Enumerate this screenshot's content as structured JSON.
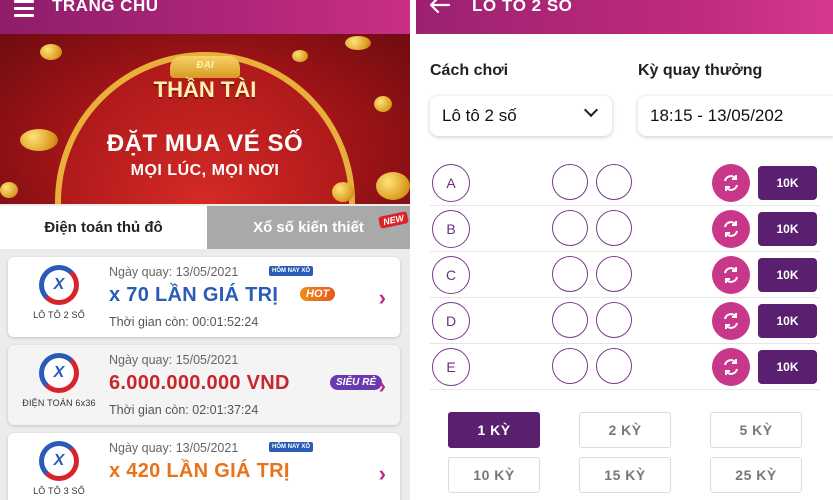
{
  "left": {
    "header_title": "TRANG CHỦ",
    "banner": {
      "logo_small": "ĐẠI",
      "logo_main": "THẦN TÀI",
      "headline": "ĐẶT MUA VÉ SỐ",
      "subline": "MỌI LÚC, MỌI NƠI"
    },
    "tabs": [
      {
        "label": "Điện toán thủ đô",
        "active": true
      },
      {
        "label": "Xổ số kiến thiết",
        "active": false,
        "badge": "NEW"
      }
    ],
    "games": [
      {
        "logo_name": "LÔ TÔ 2 SỐ",
        "date": "Ngày quay: 13/05/2021",
        "today_badge": "HÔM NAY XỔ",
        "prize": "x 70 LẦN GIÁ TRỊ",
        "prize_color": "#2a5bb8",
        "badge": "HOT",
        "remaining": "Thời gian còn: 00:01:52:24"
      },
      {
        "logo_name": "ĐIỆN TOÁN 6x36",
        "date": "Ngày quay: 15/05/2021",
        "prize": "6.000.000.000 VND",
        "prize_color": "#c8262a",
        "badge": "SIÊU RẺ",
        "remaining": "Thời gian còn: 02:01:37:24"
      },
      {
        "logo_name": "LÔ TÔ 3 SỐ",
        "date": "Ngày quay: 13/05/2021",
        "today_badge": "HÔM NAY XỔ",
        "prize": "x 420 LẦN GIÁ TRỊ",
        "prize_color": "#e8731b",
        "remaining": ""
      }
    ]
  },
  "right": {
    "header_title": "LÔ TÔ 2 SỐ",
    "play_mode_label": "Cách chơi",
    "play_mode_value": "Lô tô 2 số",
    "draw_label": "Kỳ quay thưởng",
    "draw_value": "18:15 - 13/05/202",
    "rows": [
      {
        "letter": "A",
        "price": "10K"
      },
      {
        "letter": "B",
        "price": "10K"
      },
      {
        "letter": "C",
        "price": "10K"
      },
      {
        "letter": "D",
        "price": "10K"
      },
      {
        "letter": "E",
        "price": "10K"
      }
    ],
    "periods": [
      {
        "label": "1 KỲ",
        "active": true
      },
      {
        "label": "2 KỲ",
        "active": false
      },
      {
        "label": "5 KỲ",
        "active": false
      },
      {
        "label": "10 KỲ",
        "active": false
      },
      {
        "label": "15 KỲ",
        "active": false
      },
      {
        "label": "25 KỲ",
        "active": false
      }
    ],
    "accent_color": "#5a1f6e",
    "refresh_color": "#c8378a"
  }
}
